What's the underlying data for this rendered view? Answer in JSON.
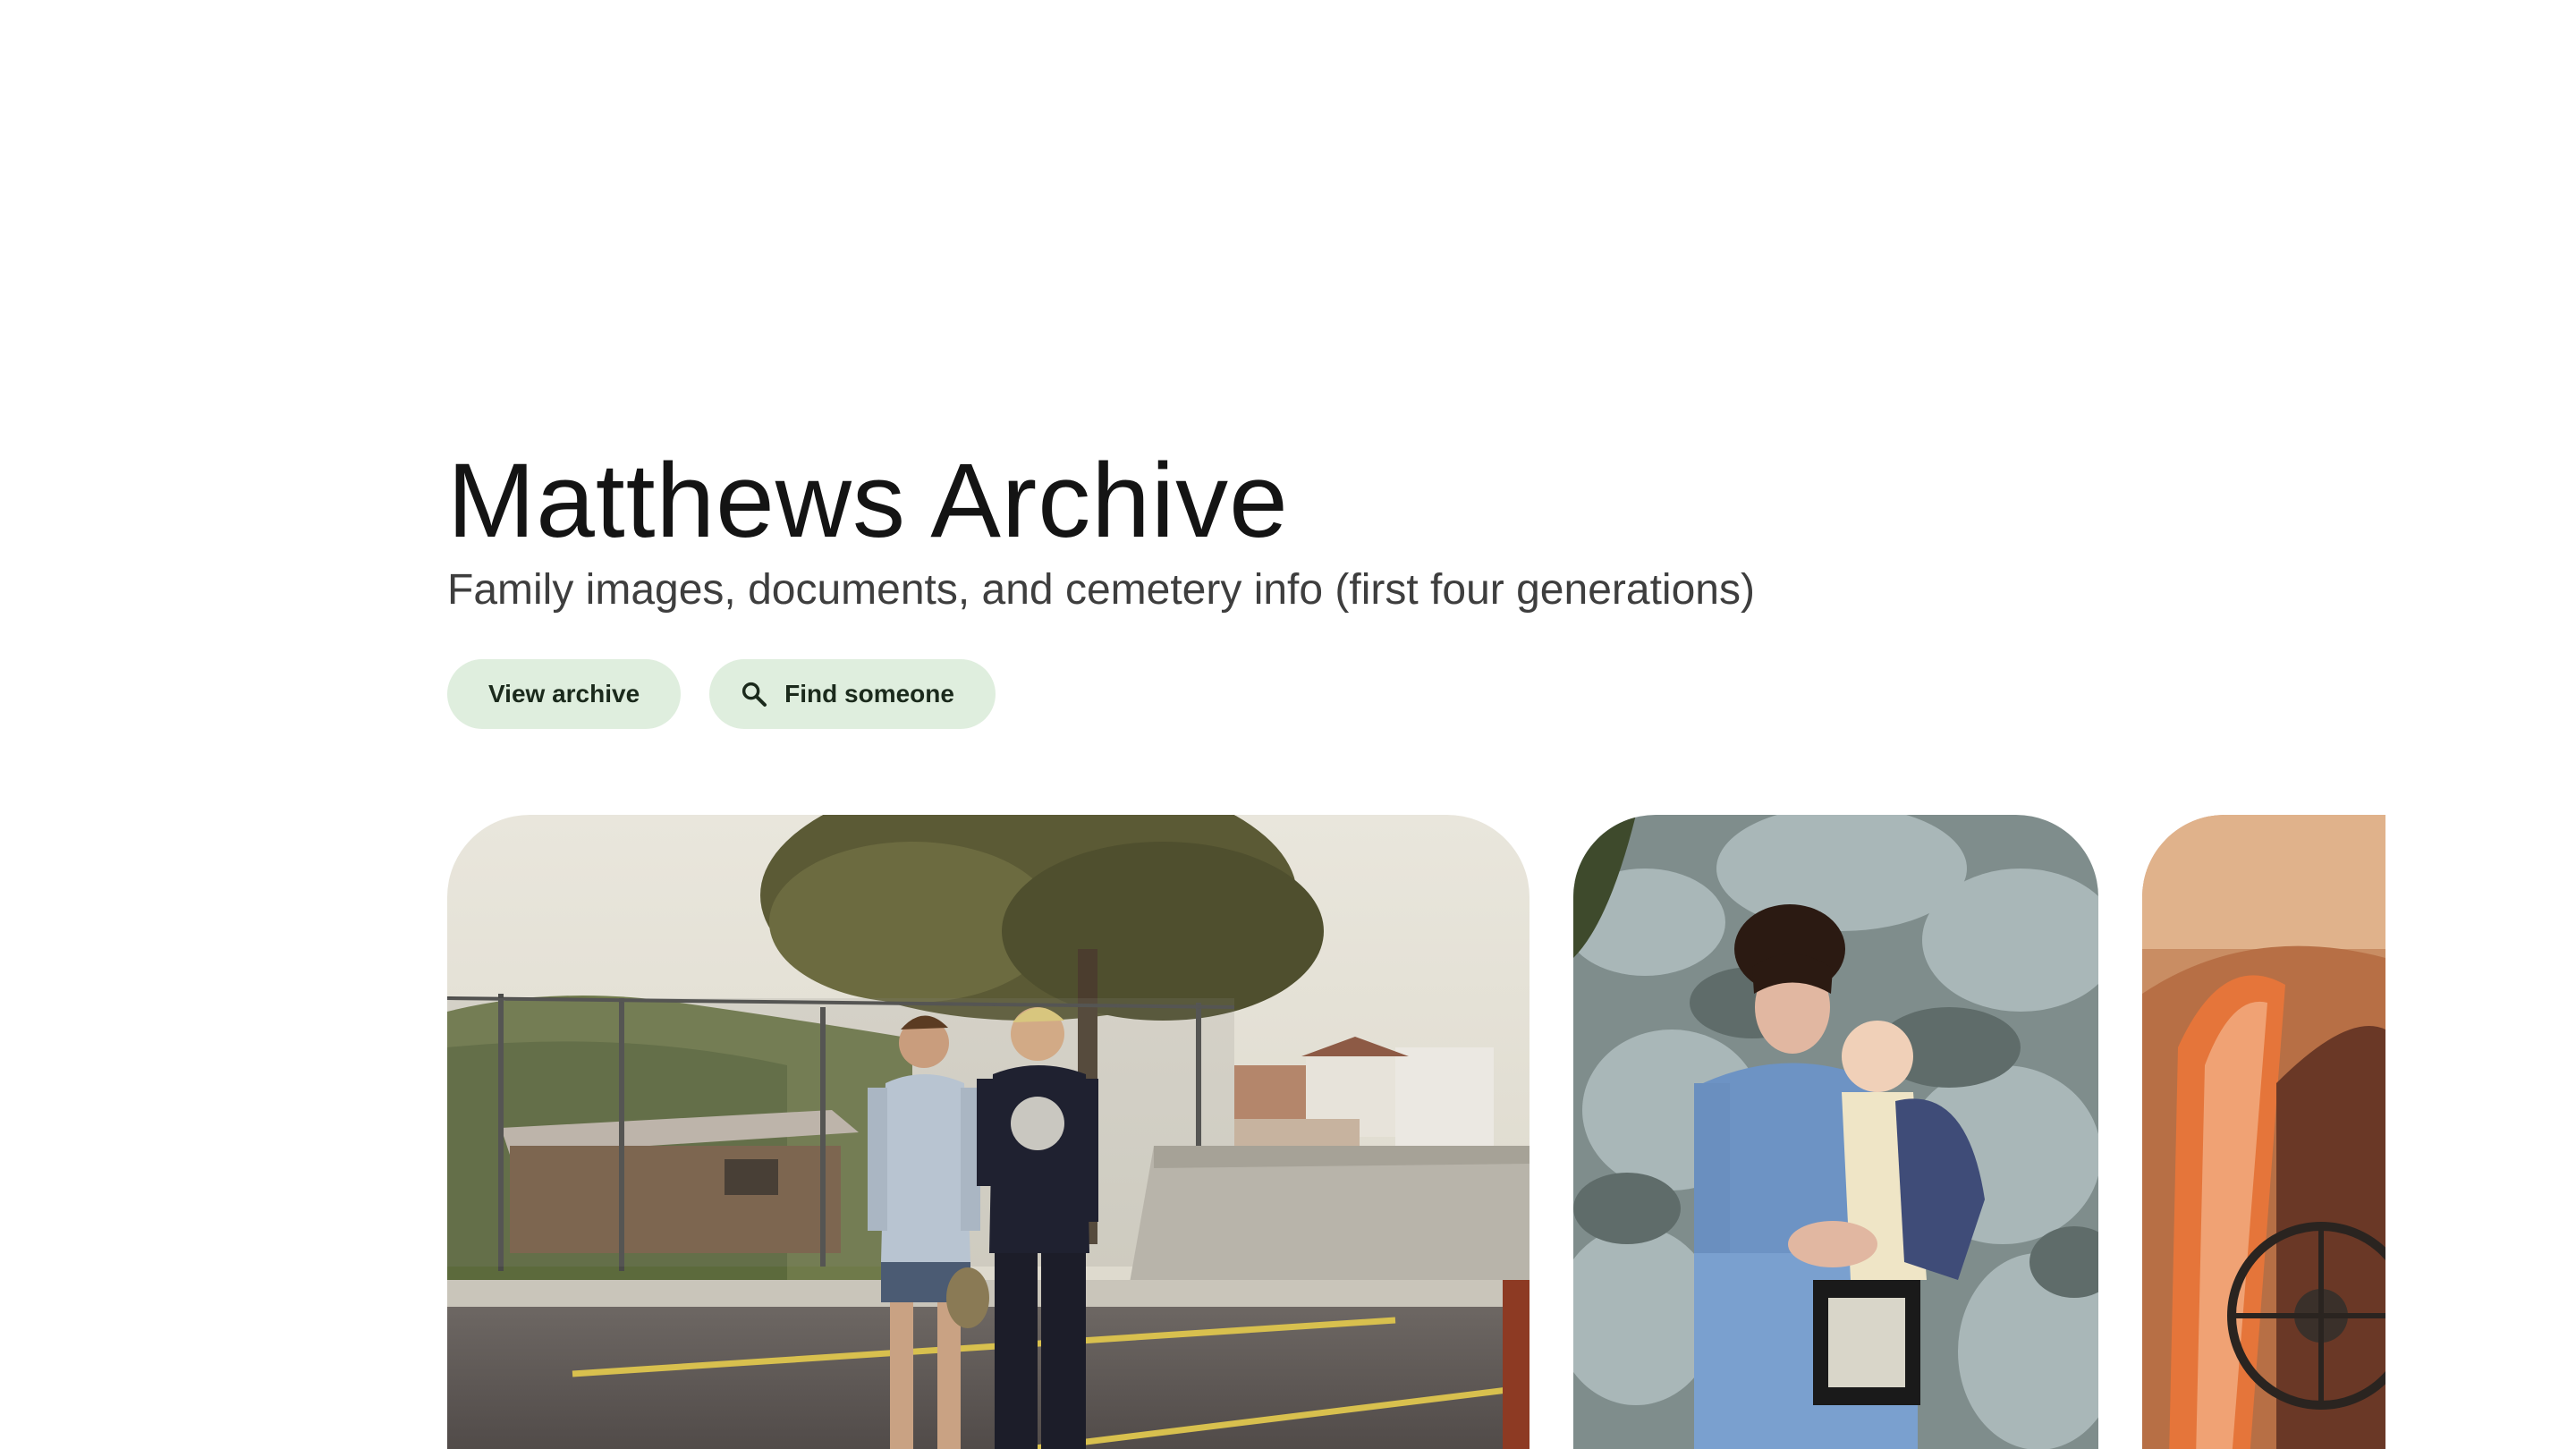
{
  "archive": {
    "title": "Matthews Archive",
    "subtitle": "Family images, documents, and cemetery info (first four generations)"
  },
  "actions": {
    "view_label": "View archive",
    "find_label": "Find someone",
    "find_icon": "search-icon"
  },
  "photos": [
    {
      "name": "two-young-men-parking-lot"
    },
    {
      "name": "woman-holding-baby-by-spruce"
    },
    {
      "name": "vintage-car-interior"
    }
  ],
  "colors": {
    "button_bg": "#dfeede",
    "title": "#141414",
    "subtitle": "#3e3e3e"
  }
}
